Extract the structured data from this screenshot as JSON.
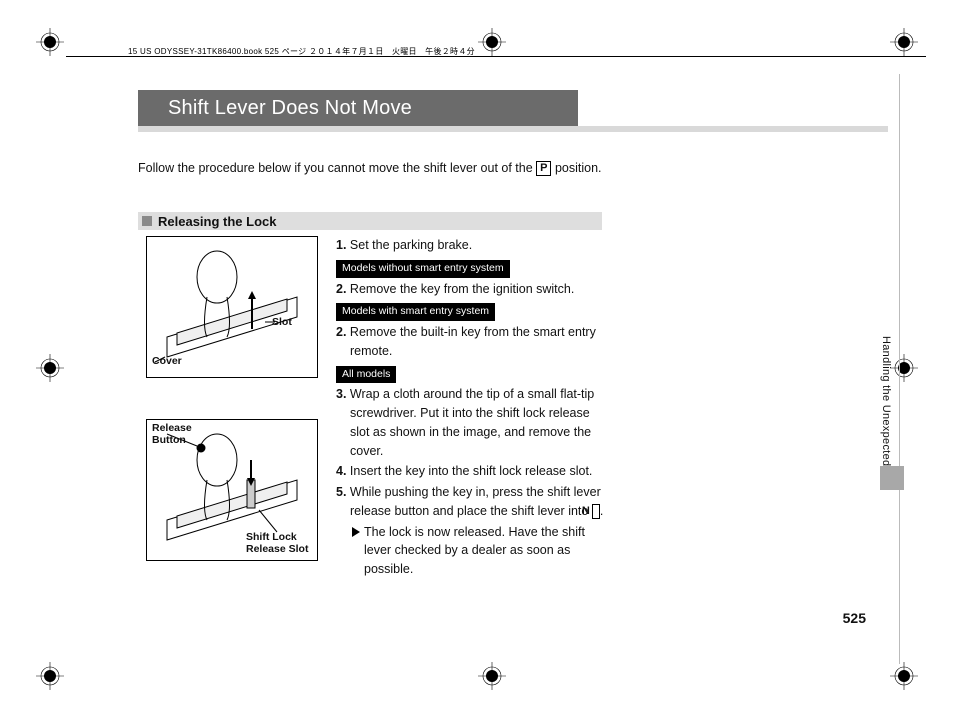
{
  "header_text": "15 US ODYSSEY-31TK86400.book  525 ページ   ２０１４年７月１日　火曜日　午後２時４分",
  "title": "Shift Lever Does Not Move",
  "intro_pre": "Follow the procedure below if you cannot move the shift lever out of the ",
  "intro_boxed": "P",
  "intro_post": " position.",
  "subheading": "Releasing the Lock",
  "callouts": {
    "slot": "Slot",
    "cover": "Cover",
    "release_button": "Release Button",
    "shift_lock_release_slot": "Shift Lock Release Slot"
  },
  "tags": {
    "without_smart": "Models without smart entry system",
    "with_smart": "Models with smart entry system",
    "all_models": "All models"
  },
  "steps": {
    "s1": "Set the parking brake.",
    "s2a": "Remove the key from the ignition switch.",
    "s2b": "Remove the built-in key from the smart entry remote.",
    "s3": "Wrap a cloth around the tip of a small flat-tip screwdriver. Put it into the shift lock release slot as shown in the image, and remove the cover.",
    "s4": "Insert the key into the shift lock release slot.",
    "s5_pre": "While pushing the key in, press the shift lever release button and place the shift lever into ",
    "s5_boxed": "N",
    "s5_post": ".",
    "s5_sub": "The lock is now released. Have the shift lever checked by a dealer as soon as possible."
  },
  "side_tab": "Handling the Unexpected",
  "page_number": "525"
}
